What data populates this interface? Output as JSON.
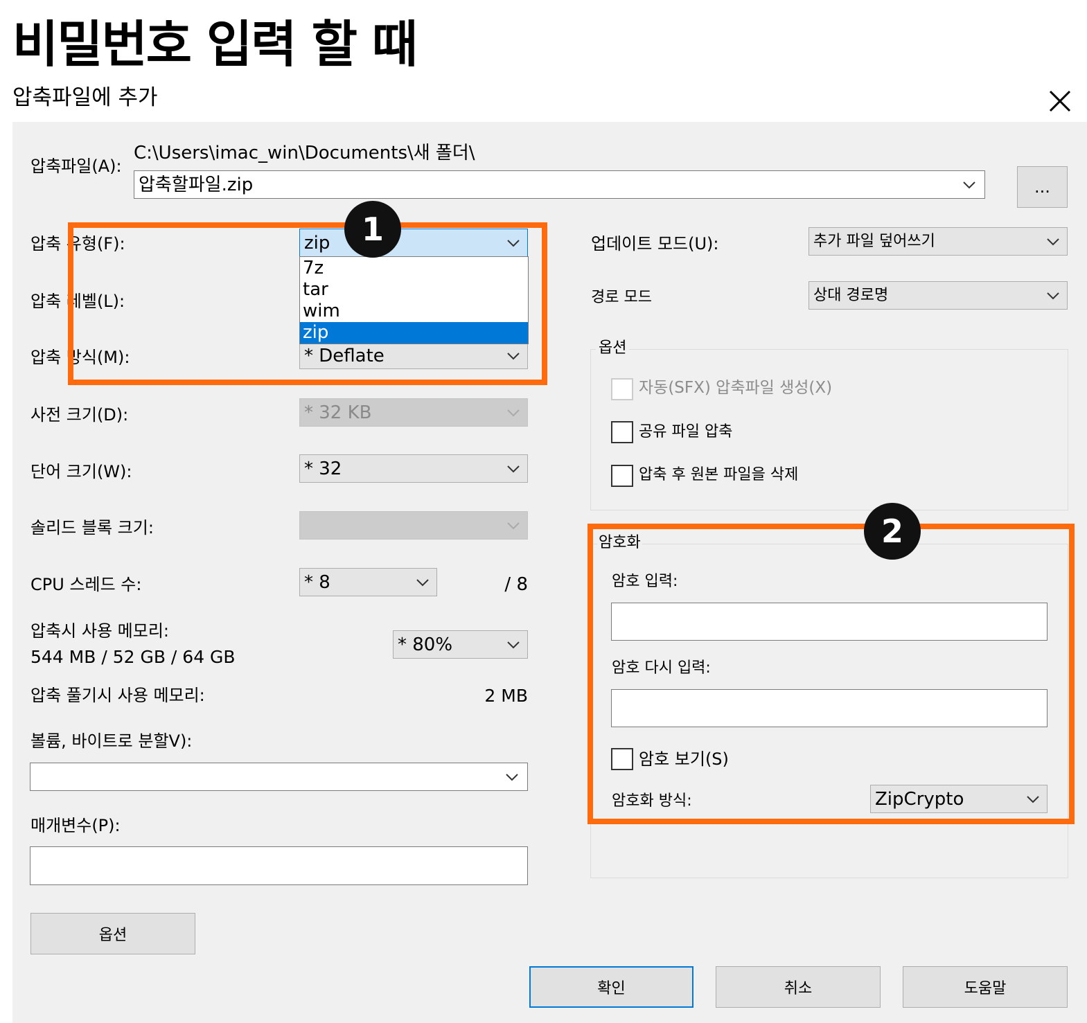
{
  "heading": "비밀번호 입력 할 때",
  "dialog": {
    "title": "압축파일에 추가",
    "close_icon": "close-icon"
  },
  "archive": {
    "label": "압축파일(A):",
    "path": "C:\\Users\\imac_win\\Documents\\새 폴더\\",
    "filename": "압축할파일.zip",
    "browse": "..."
  },
  "left": {
    "format_label": "압축 유형(F):",
    "format_value": "zip",
    "format_options": [
      "7z",
      "tar",
      "wim",
      "zip"
    ],
    "format_selected": "zip",
    "level_label": "압축 레벨(L):",
    "method_label": "압축 방식(M):",
    "method_value": "*  Deflate",
    "dict_label": "사전 크기(D):",
    "dict_value": "*  32 KB",
    "word_label": "단어 크기(W):",
    "word_value": "*  32",
    "solid_label": "솔리드 블록 크기:",
    "solid_value": "",
    "cpu_label": "CPU 스레드 수:",
    "cpu_value": "*  8",
    "cpu_total": "/ 8",
    "mem_label": "압축시 사용 메모리:",
    "mem_value_text": "544 MB / 52 GB / 64 GB",
    "mem_percent": "*  80%",
    "decomp_label": "압축 풀기시 사용 메모리:",
    "decomp_value": "2 MB",
    "split_label": "볼륨, 바이트로 분할V):",
    "split_value": "",
    "params_label": "매개변수(P):",
    "params_value": "",
    "options_button": "옵션"
  },
  "right": {
    "update_label": "업데이트 모드(U):",
    "update_value": "추가 파일 덮어쓰기",
    "path_label": "경로 모드",
    "path_value": "상대 경로명",
    "options_group": "옵션",
    "sfx_label": "자동(SFX) 압축파일 생성(X)",
    "shared_label": "공유 파일 압축",
    "delete_label": "압축 후 원본 파일을 삭제",
    "encryption_group": "암호화",
    "password_label": "암호 입력:",
    "password_value": "",
    "reenter_label": "암호 다시 입력:",
    "reenter_value": "",
    "show_password_label": "암호 보기(S)",
    "enc_method_label": "암호화 방식:",
    "enc_method_value": "ZipCrypto"
  },
  "buttons": {
    "ok": "확인",
    "cancel": "취소",
    "help": "도움말"
  },
  "badges": {
    "one": "1",
    "two": "2"
  },
  "colors": {
    "highlight": "#ff6a0d",
    "selection": "#0078d7",
    "panel": "#f0f0f0"
  }
}
